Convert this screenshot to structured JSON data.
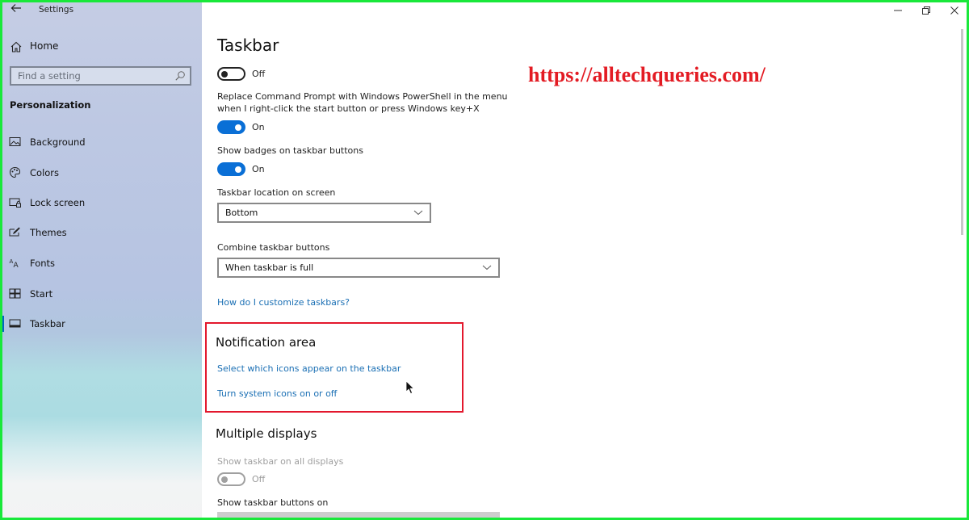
{
  "window": {
    "app_title": "Settings",
    "controls": {
      "minimize": "minimize-icon",
      "maximize": "restore-icon",
      "close": "close-icon"
    }
  },
  "sidebar": {
    "back_icon": "arrow-left-icon",
    "home": {
      "label": "Home",
      "icon": "home-icon"
    },
    "search": {
      "placeholder": "Find a setting",
      "value": "",
      "icon": "search-icon"
    },
    "section_title": "Personalization",
    "items": [
      {
        "label": "Background",
        "icon": "image-icon",
        "active": false
      },
      {
        "label": "Colors",
        "icon": "palette-icon",
        "active": false
      },
      {
        "label": "Lock screen",
        "icon": "lock-screen-icon",
        "active": false
      },
      {
        "label": "Themes",
        "icon": "themes-icon",
        "active": false
      },
      {
        "label": "Fonts",
        "icon": "fonts-icon",
        "active": false
      },
      {
        "label": "Start",
        "icon": "start-icon",
        "active": false
      },
      {
        "label": "Taskbar",
        "icon": "taskbar-icon",
        "active": true
      }
    ]
  },
  "main": {
    "title": "Taskbar",
    "settings": {
      "top_toggle": {
        "state": "Off",
        "on": false
      },
      "powershell": {
        "line1": "Replace Command Prompt with Windows PowerShell in the menu",
        "line2": "when I right-click the start button or press Windows key+X",
        "state": "On",
        "on": true
      },
      "badges": {
        "label": "Show badges on taskbar buttons",
        "state": "On",
        "on": true
      },
      "location": {
        "label": "Taskbar location on screen",
        "value": "Bottom"
      },
      "combine": {
        "label": "Combine taskbar buttons",
        "value": "When taskbar is full"
      },
      "help_link": "How do I customize taskbars?"
    },
    "notification_area": {
      "title": "Notification area",
      "links": [
        "Select which icons appear on the taskbar",
        "Turn system icons on or off"
      ]
    },
    "multiple_displays": {
      "title": "Multiple displays",
      "show_all": {
        "label": "Show taskbar on all displays",
        "state": "Off",
        "on": false,
        "disabled": true
      },
      "buttons_on": {
        "label": "Show taskbar buttons on"
      }
    }
  },
  "watermark": "https://alltechqueries.com/",
  "colors": {
    "accent": "#0a6fd6",
    "link": "#1a6fb4",
    "highlight": "#e3182d",
    "watermark": "#e31b23",
    "frame": "#19e83a"
  }
}
